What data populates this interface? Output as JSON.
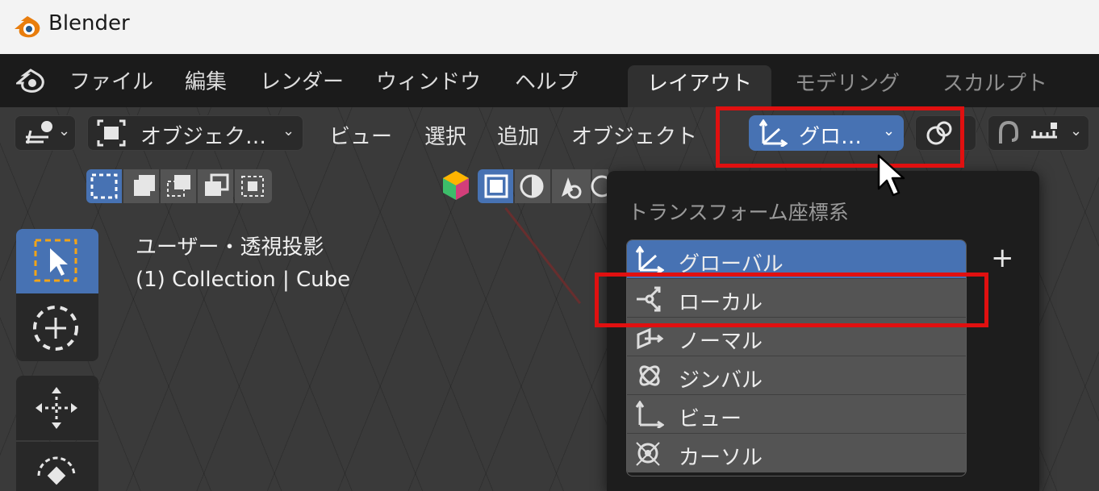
{
  "window": {
    "title": "Blender"
  },
  "menubar": {
    "items": [
      "ファイル",
      "編集",
      "レンダー",
      "ウィンドウ",
      "ヘルプ"
    ]
  },
  "workspaces": {
    "tabs": [
      "レイアウト",
      "モデリング",
      "スカルプト"
    ],
    "active": "レイアウト"
  },
  "header": {
    "mode_label": "オブジェク…",
    "menus": [
      "ビュー",
      "選択",
      "追加",
      "オブジェクト"
    ],
    "orientation_label": "グロ…"
  },
  "overlay": {
    "view_name": "ユーザー・透視投影",
    "object_info": "(1) Collection | Cube"
  },
  "orientation_menu": {
    "title": "トランスフォーム座標系",
    "add_label": "+",
    "items": [
      {
        "label": "グローバル",
        "icon": "global-orientation-icon",
        "selected": true
      },
      {
        "label": "ローカル",
        "icon": "local-orientation-icon",
        "selected": false
      },
      {
        "label": "ノーマル",
        "icon": "normal-orientation-icon",
        "selected": false
      },
      {
        "label": "ジンバル",
        "icon": "gimbal-orientation-icon",
        "selected": false
      },
      {
        "label": "ビュー",
        "icon": "view-orientation-icon",
        "selected": false
      },
      {
        "label": "カーソル",
        "icon": "cursor-orientation-icon",
        "selected": false
      }
    ]
  },
  "colors": {
    "accent": "#4772b3",
    "highlight": "#e01010",
    "menu_bg": "#1d1d1d",
    "item_bg": "#545454"
  }
}
